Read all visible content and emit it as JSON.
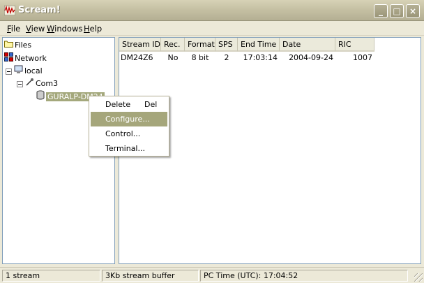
{
  "window": {
    "title": "Scream!",
    "minimize_label": "_",
    "maximize_label": "□",
    "close_label": "×"
  },
  "menubar": {
    "file": {
      "accel": "F",
      "rest": "ile"
    },
    "view": {
      "accel": "V",
      "rest": "iew"
    },
    "windows": {
      "accel": "W",
      "rest": "indows"
    },
    "help": {
      "accel": "H",
      "rest": "elp"
    }
  },
  "tree": {
    "files": "Files",
    "network": "Network",
    "local": "local",
    "com3": "Com3",
    "device": "GURALP-DM24"
  },
  "table": {
    "columns": [
      "Stream ID",
      "Rec.",
      "Format",
      "SPS",
      "End Time",
      "Date",
      "RIC"
    ],
    "rows": [
      [
        "DM24Z6",
        "No",
        "8 bit",
        "2",
        "17:03:14",
        "2004-09-24",
        "1007"
      ]
    ]
  },
  "context_menu": {
    "items": [
      {
        "label": "Delete",
        "shortcut": "Del"
      },
      {
        "label": "Configure..."
      },
      {
        "label": "Control..."
      },
      {
        "label": "Terminal..."
      }
    ]
  },
  "statusbar": {
    "count": "1 stream",
    "buffer": "3Kb stream buffer",
    "time": "PC Time (UTC):  17:04:52"
  },
  "colors": {
    "highlight": "#a5a67b",
    "titlebar": "#c6c1a4"
  }
}
